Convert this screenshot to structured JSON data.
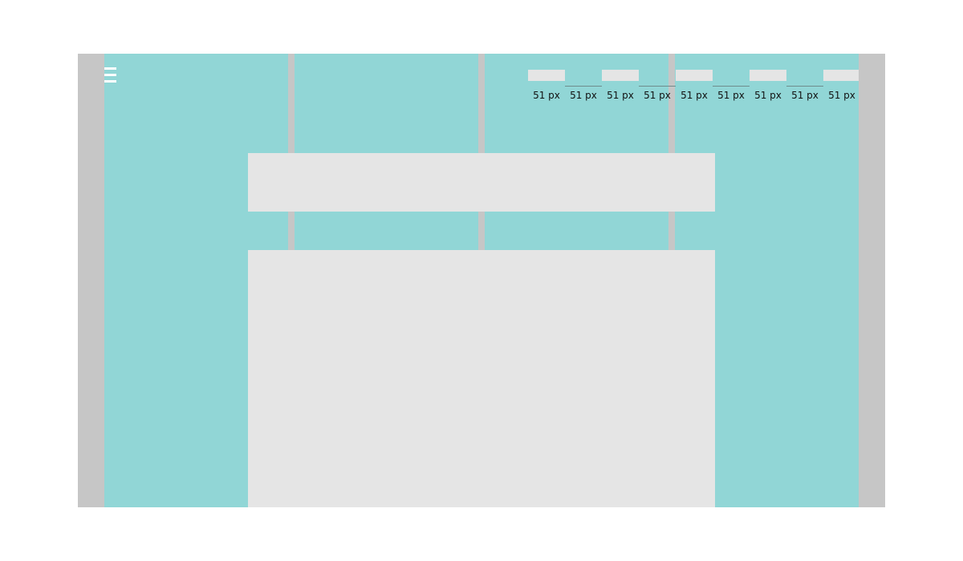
{
  "colors": {
    "background": "#ffffff",
    "frame": "#c6c6c6",
    "grid_column": "#91d6d6",
    "panel": "#e5e5e5",
    "ruler_line": "#6f8c8c",
    "menu_icon": "#ffffff"
  },
  "menu": {
    "icon": "hamburger-menu-icon"
  },
  "ruler": {
    "segments": [
      {
        "label": "51 px",
        "kind": "block"
      },
      {
        "label": "51 px",
        "kind": "line"
      },
      {
        "label": "51 px",
        "kind": "block"
      },
      {
        "label": "51 px",
        "kind": "line"
      },
      {
        "label": "51 px",
        "kind": "block"
      },
      {
        "label": "51 px",
        "kind": "line"
      },
      {
        "label": "51 px",
        "kind": "block"
      },
      {
        "label": "51 px",
        "kind": "line"
      },
      {
        "label": "51 px",
        "kind": "block"
      }
    ]
  },
  "grid": {
    "columns": 4
  },
  "panels": [
    "header-panel",
    "main-panel"
  ]
}
